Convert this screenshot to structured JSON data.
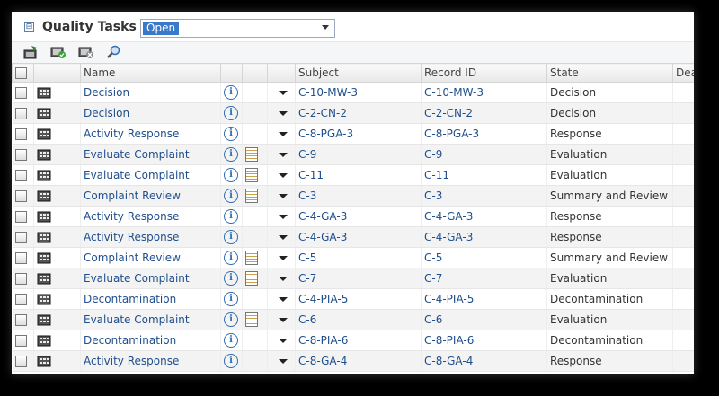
{
  "header": {
    "title": "Quality Tasks",
    "filter_value": "Open",
    "collapse_glyph": "⊟"
  },
  "toolbar": {
    "icons": [
      "new-task-icon",
      "approve-icon",
      "reject-icon",
      "search-icon"
    ]
  },
  "columns": [
    "Name",
    "Subject",
    "Record ID",
    "State",
    "Dea"
  ],
  "rows": [
    {
      "name": "Decision",
      "subject": "C-10-MW-3",
      "record": "C-10-MW-3",
      "state": "Decision",
      "note": false
    },
    {
      "name": "Decision",
      "subject": "C-2-CN-2",
      "record": "C-2-CN-2",
      "state": "Decision",
      "note": false
    },
    {
      "name": "Activity Response",
      "subject": "C-8-PGA-3",
      "record": "C-8-PGA-3",
      "state": "Response",
      "note": false
    },
    {
      "name": "Evaluate Complaint",
      "subject": "C-9",
      "record": "C-9",
      "state": "Evaluation",
      "note": true
    },
    {
      "name": "Evaluate Complaint",
      "subject": "C-11",
      "record": "C-11",
      "state": "Evaluation",
      "note": true
    },
    {
      "name": "Complaint Review",
      "subject": "C-3",
      "record": "C-3",
      "state": "Summary and Review",
      "note": true
    },
    {
      "name": "Activity Response",
      "subject": "C-4-GA-3",
      "record": "C-4-GA-3",
      "state": "Response",
      "note": false
    },
    {
      "name": "Activity Response",
      "subject": "C-4-GA-3",
      "record": "C-4-GA-3",
      "state": "Response",
      "note": false
    },
    {
      "name": "Complaint Review",
      "subject": "C-5",
      "record": "C-5",
      "state": "Summary and Review",
      "note": true
    },
    {
      "name": "Evaluate Complaint",
      "subject": "C-7",
      "record": "C-7",
      "state": "Evaluation",
      "note": true
    },
    {
      "name": "Decontamination",
      "subject": "C-4-PIA-5",
      "record": "C-4-PIA-5",
      "state": "Decontamination",
      "note": false
    },
    {
      "name": "Evaluate Complaint",
      "subject": "C-6",
      "record": "C-6",
      "state": "Evaluation",
      "note": true
    },
    {
      "name": "Decontamination",
      "subject": "C-8-PIA-6",
      "record": "C-8-PIA-6",
      "state": "Decontamination",
      "note": false
    },
    {
      "name": "Activity Response",
      "subject": "C-8-GA-4",
      "record": "C-8-GA-4",
      "state": "Response",
      "note": false
    }
  ]
}
